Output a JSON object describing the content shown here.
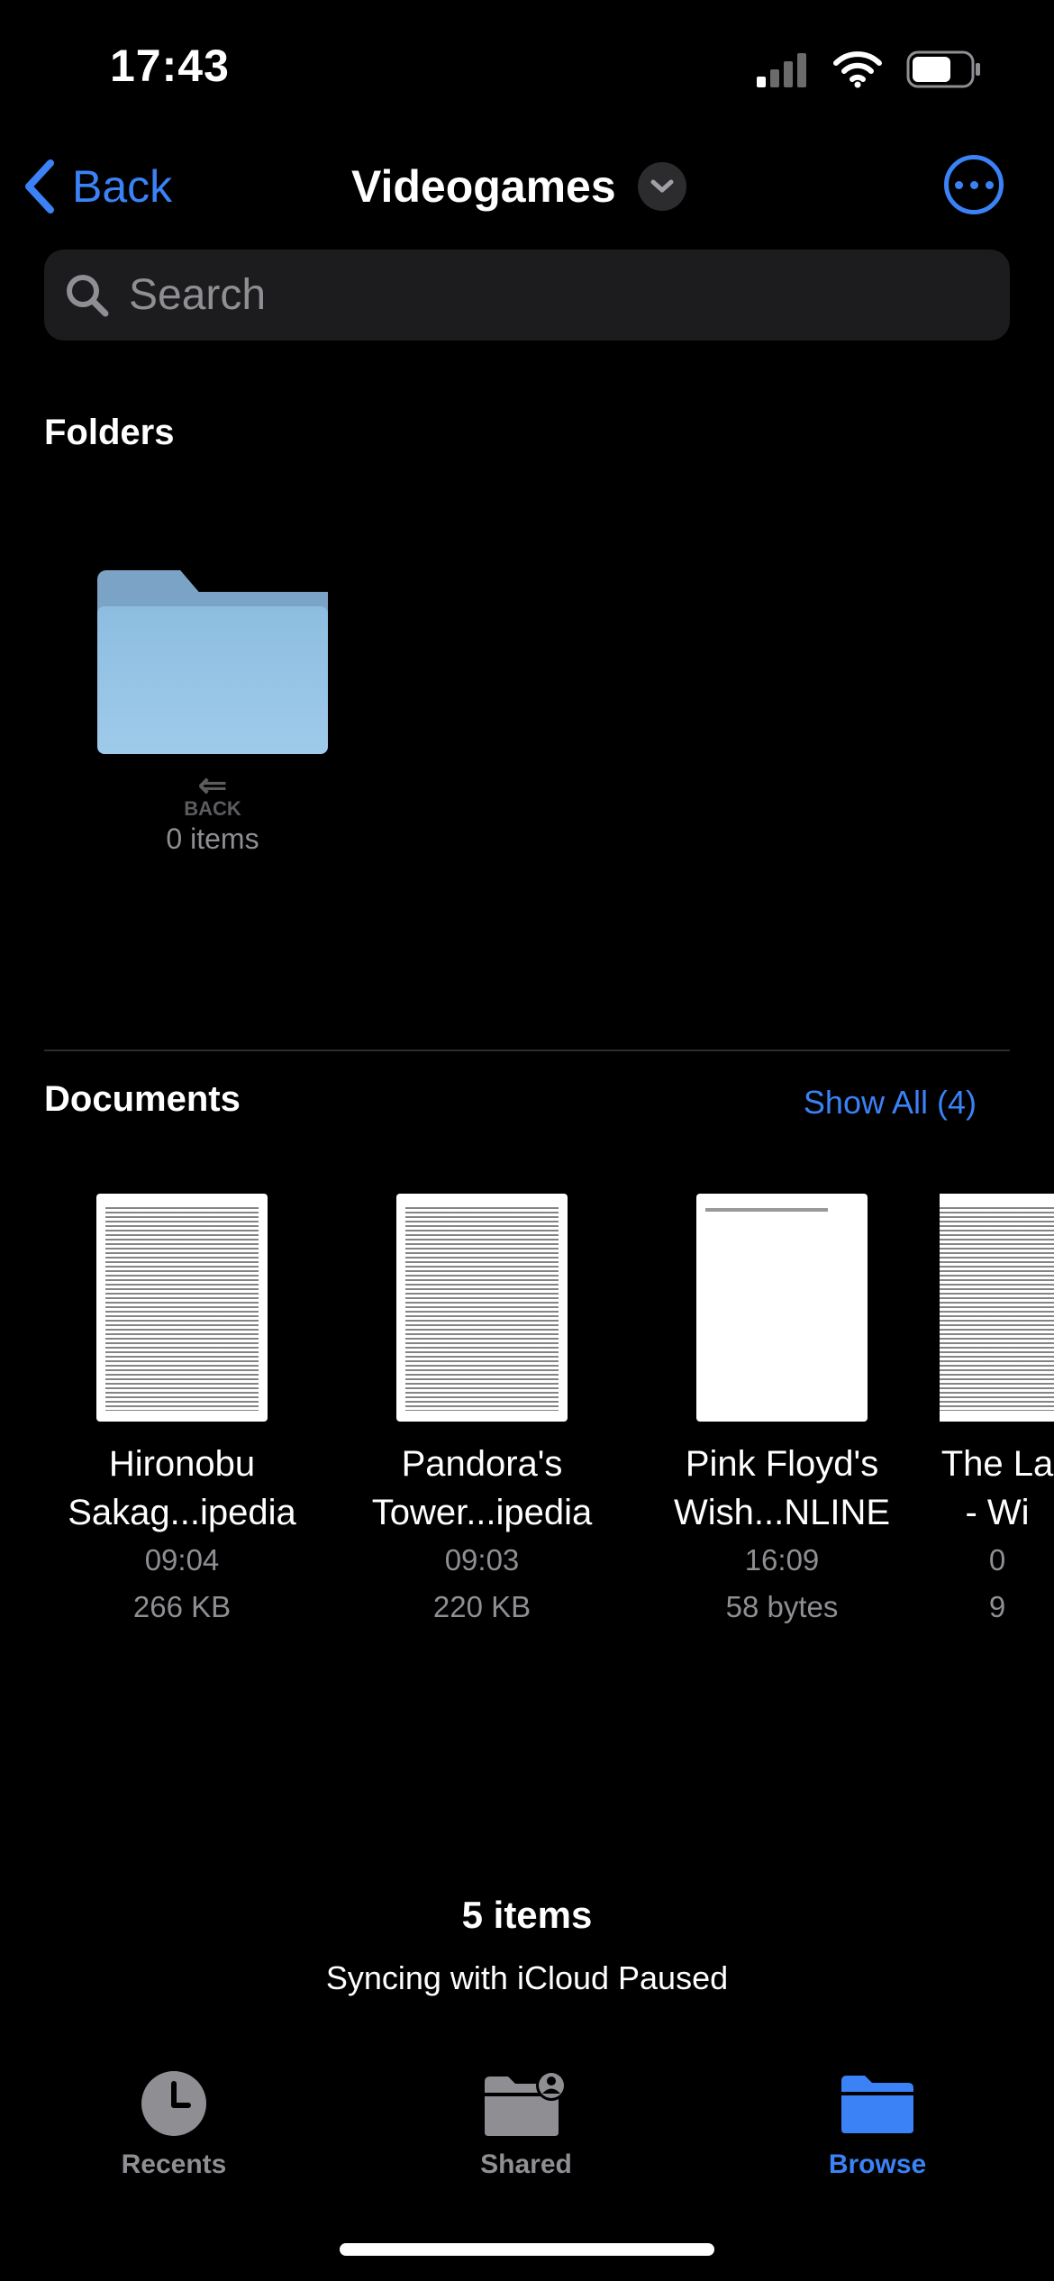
{
  "status_bar": {
    "time": "17:43"
  },
  "nav": {
    "back_label": "Back",
    "title": "Videogames"
  },
  "search": {
    "placeholder": "Search"
  },
  "sections": {
    "folders_heading": "Folders",
    "documents_heading": "Documents",
    "show_all_label": "Show All (4)"
  },
  "folders": [
    {
      "name_icon_label": "BACK",
      "count": "0 items"
    }
  ],
  "documents": [
    {
      "name_line1": "Hironobu",
      "name_line2": "Sakag...ipedia",
      "time": "09:04",
      "size": "266 KB"
    },
    {
      "name_line1": "Pandora's",
      "name_line2": "Tower...ipedia",
      "time": "09:03",
      "size": "220 KB"
    },
    {
      "name_line1": "Pink Floyd's",
      "name_line2": "Wish...NLINE",
      "time": "16:09",
      "size": "58 bytes"
    },
    {
      "name_line1": "The La",
      "name_line2": "- Wi",
      "time": "0",
      "size": "9"
    }
  ],
  "footer": {
    "items_count": "5 items",
    "sync_status": "Syncing with iCloud Paused"
  },
  "tabbar": {
    "recents_label": "Recents",
    "shared_label": "Shared",
    "browse_label": "Browse",
    "active_tab": "Browse"
  },
  "colors": {
    "accent": "#3b82f6",
    "secondary_text": "#8e8e93",
    "background": "#000000"
  }
}
